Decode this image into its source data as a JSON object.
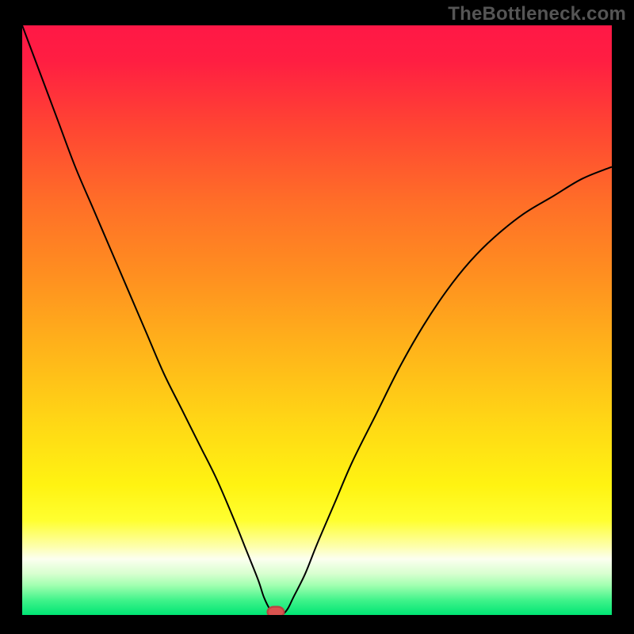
{
  "watermark": "TheBottleneck.com",
  "chart_data": {
    "type": "line",
    "title": "",
    "xlabel": "",
    "ylabel": "",
    "xlim": [
      0,
      100
    ],
    "ylim": [
      0,
      100
    ],
    "gradient_stops": [
      {
        "offset": 0.0,
        "color": "#ff1846"
      },
      {
        "offset": 0.06,
        "color": "#ff1e42"
      },
      {
        "offset": 0.17,
        "color": "#ff4433"
      },
      {
        "offset": 0.3,
        "color": "#ff6e28"
      },
      {
        "offset": 0.42,
        "color": "#ff8e20"
      },
      {
        "offset": 0.55,
        "color": "#ffb41a"
      },
      {
        "offset": 0.68,
        "color": "#ffd915"
      },
      {
        "offset": 0.78,
        "color": "#fff312"
      },
      {
        "offset": 0.84,
        "color": "#ffff30"
      },
      {
        "offset": 0.885,
        "color": "#fdffb0"
      },
      {
        "offset": 0.905,
        "color": "#fcfff0"
      },
      {
        "offset": 0.93,
        "color": "#d8ffcf"
      },
      {
        "offset": 0.95,
        "color": "#a0ffb0"
      },
      {
        "offset": 0.975,
        "color": "#40f38a"
      },
      {
        "offset": 1.0,
        "color": "#00e574"
      }
    ],
    "series": [
      {
        "name": "bottleneck-curve",
        "x": [
          0,
          3,
          6,
          9,
          12,
          15,
          18,
          21,
          24,
          27,
          30,
          33,
          36,
          38,
          40,
          41,
          42,
          43,
          44,
          45,
          46,
          48,
          50,
          53,
          56,
          60,
          64,
          68,
          72,
          76,
          80,
          85,
          90,
          95,
          100
        ],
        "y": [
          100,
          92,
          84,
          76,
          69,
          62,
          55,
          48,
          41,
          35,
          29,
          23,
          16,
          11,
          6,
          3,
          1,
          0,
          0,
          1,
          3,
          7,
          12,
          19,
          26,
          34,
          42,
          49,
          55,
          60,
          64,
          68,
          71,
          74,
          76
        ]
      }
    ],
    "marker": {
      "x": 43,
      "y": 0.5,
      "label": "optimal-point"
    }
  }
}
